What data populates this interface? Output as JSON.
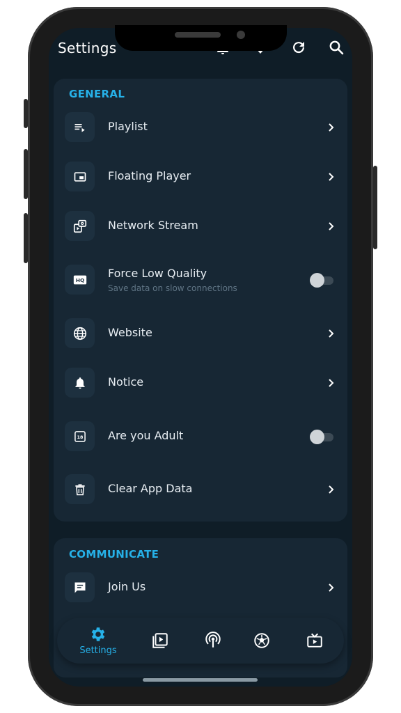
{
  "header": {
    "title": "Settings"
  },
  "sections": [
    {
      "label": "GENERAL",
      "items": [
        {
          "label": "Playlist",
          "icon": "playlist-icon",
          "control": "chevron"
        },
        {
          "label": "Floating Player",
          "icon": "picture-in-picture-icon",
          "control": "chevron"
        },
        {
          "label": "Network Stream",
          "icon": "network-stream-icon",
          "control": "chevron"
        },
        {
          "label": "Force Low Quality",
          "sublabel": "Save data on slow connections",
          "icon": "hq-icon",
          "control": "toggle",
          "on": false
        },
        {
          "label": "Website",
          "icon": "globe-icon",
          "control": "chevron"
        },
        {
          "label": "Notice",
          "icon": "bell-icon",
          "control": "chevron"
        },
        {
          "label": "Are you Adult",
          "icon": "18-plus-icon",
          "control": "toggle",
          "on": false
        },
        {
          "label": "Clear App Data",
          "icon": "trash-icon",
          "control": "chevron"
        }
      ]
    },
    {
      "label": "COMMUNICATE",
      "items": [
        {
          "label": "Join Us",
          "icon": "chat-icon",
          "control": "chevron"
        }
      ]
    }
  ],
  "bottom_nav": [
    {
      "label": "Settings",
      "icon": "gear-icon",
      "active": true
    },
    {
      "icon": "video-library-icon"
    },
    {
      "icon": "broadcast-icon"
    },
    {
      "icon": "football-icon"
    },
    {
      "icon": "tv-icon"
    }
  ],
  "colors": {
    "accent": "#26b1e8",
    "background": "#0f1d27",
    "card": "#172734"
  }
}
